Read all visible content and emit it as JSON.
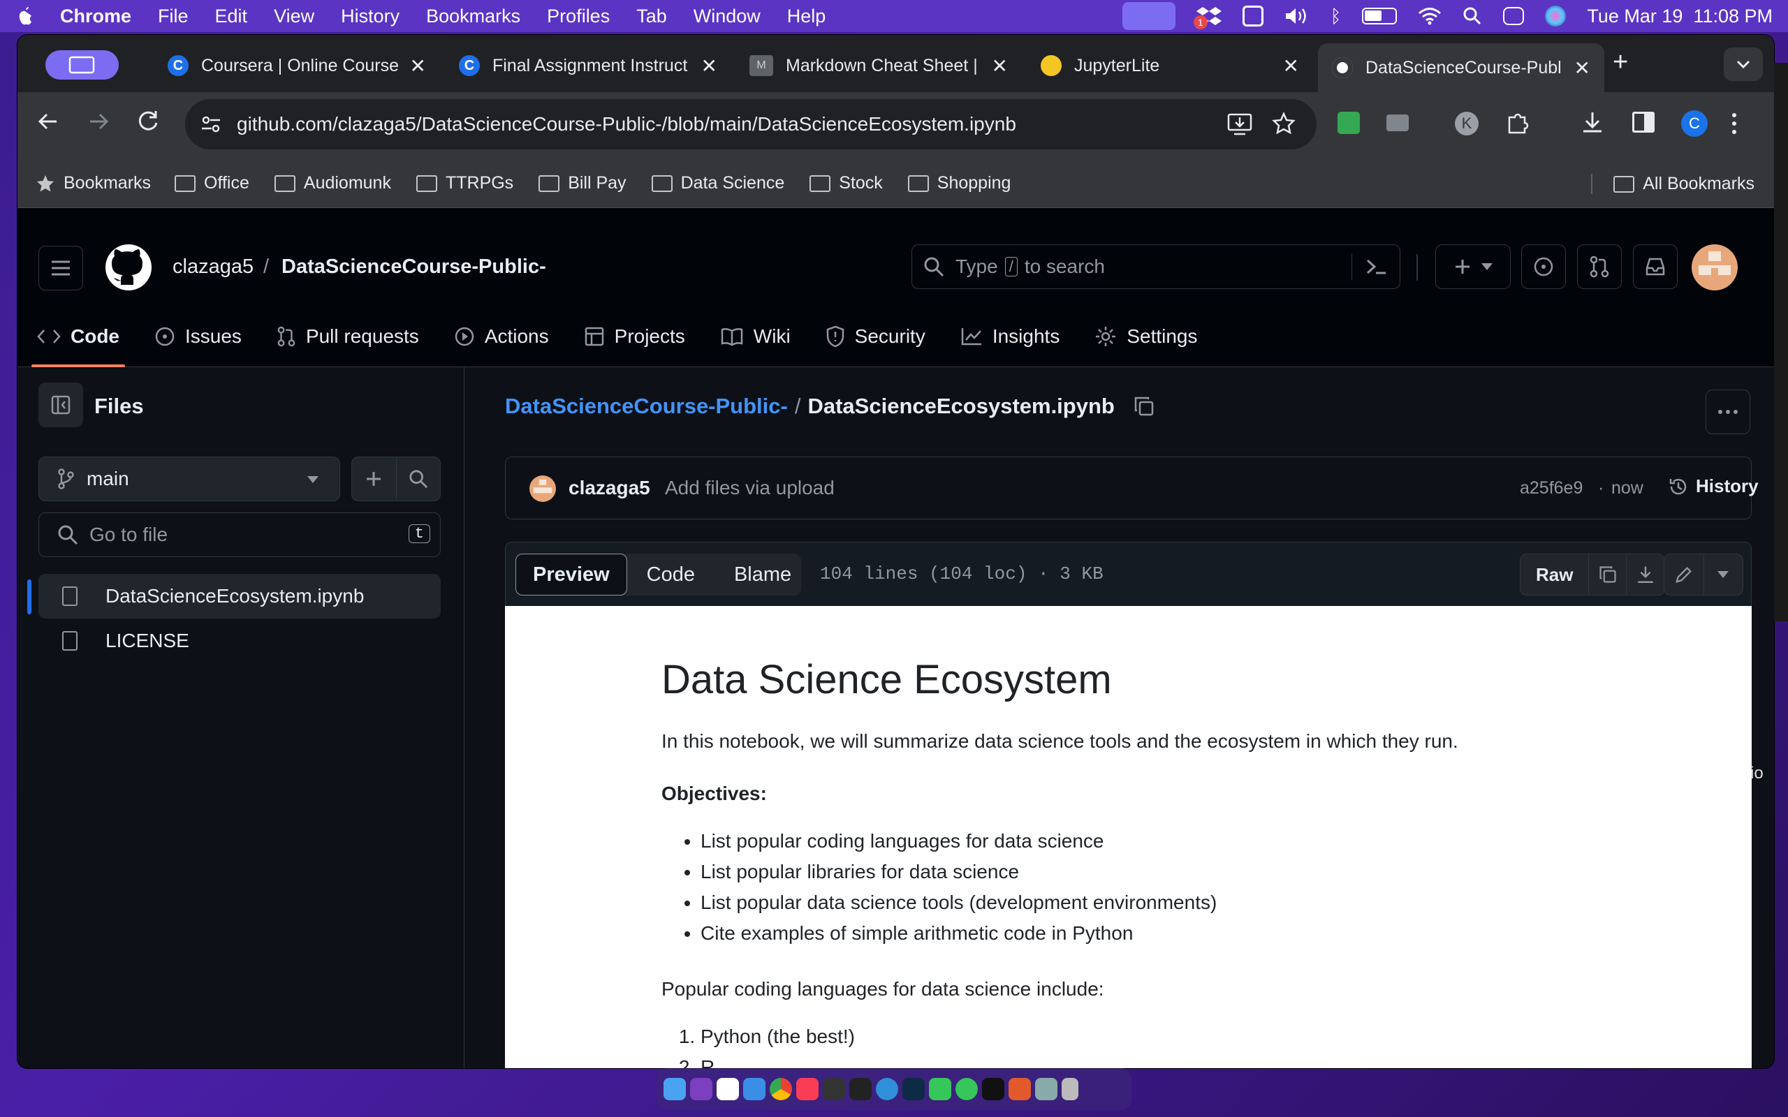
{
  "menubar": {
    "items": [
      "Chrome",
      "File",
      "Edit",
      "View",
      "History",
      "Bookmarks",
      "Profiles",
      "Tab",
      "Window",
      "Help"
    ],
    "datetime": "Tue Mar 19  11:08 PM",
    "badge": "1"
  },
  "tabs": [
    {
      "title": "Coursera | Online Course",
      "fav_color": "#1f6feb",
      "fav_letter": "C"
    },
    {
      "title": "Final Assignment Instruct",
      "fav_color": "#1f6feb",
      "fav_letter": "C"
    },
    {
      "title": "Markdown Cheat Sheet |",
      "fav_color": "#5f6368",
      "fav_letter": "M"
    },
    {
      "title": "JupyterLite",
      "fav_color": "#f3c623",
      "fav_letter": ""
    },
    {
      "title": "DataScienceCourse-Publ",
      "fav_color": "#ffffff",
      "fav_letter": ""
    }
  ],
  "url": "github.com/clazaga5/DataScienceCourse-Public-/blob/main/DataScienceEcosystem.ipynb",
  "profile_letter": "C",
  "ext_letter": "K",
  "bookmarks": {
    "star_label": "Bookmarks",
    "folders": [
      "Office",
      "Audiomunk",
      "TTRPGs",
      "Bill Pay",
      "Data Science",
      "Stock",
      "Shopping"
    ],
    "all": "All Bookmarks"
  },
  "gh": {
    "owner": "clazaga5",
    "sep": "/",
    "repo": "DataScienceCourse-Public-",
    "search_pre": "Type",
    "search_key": "/",
    "search_post": "to search",
    "nav": [
      "Code",
      "Issues",
      "Pull requests",
      "Actions",
      "Projects",
      "Wiki",
      "Security",
      "Insights",
      "Settings"
    ]
  },
  "sidebar": {
    "title": "Files",
    "branch": "main",
    "goto_placeholder": "Go to file",
    "goto_key": "t",
    "files": [
      "DataScienceEcosystem.ipynb",
      "LICENSE"
    ]
  },
  "file": {
    "repo_link": "DataScienceCourse-Public-",
    "sep": "/",
    "name": "DataScienceEcosystem.ipynb",
    "commit_author": "clazaga5",
    "commit_msg": "Add files via upload",
    "commit_hash": "a25f6e9",
    "commit_time": "now",
    "history": "History",
    "views": [
      "Preview",
      "Code",
      "Blame"
    ],
    "meta": "104 lines (104 loc) · 3 KB",
    "raw": "Raw"
  },
  "notebook": {
    "h1": "Data Science Ecosystem",
    "intro": "In this notebook, we will summarize data science tools and the ecosystem in which they run.",
    "objectives_label": "Objectives:",
    "objectives": [
      "List popular coding languages for data science",
      "List popular libraries for data science",
      "List popular data science tools (development environments)",
      "Cite examples of simple arithmetic code in Python"
    ],
    "languages_intro": "Popular coding languages for data science include:",
    "languages": [
      "Python (the best!)",
      "R"
    ]
  },
  "peek_text": "io"
}
